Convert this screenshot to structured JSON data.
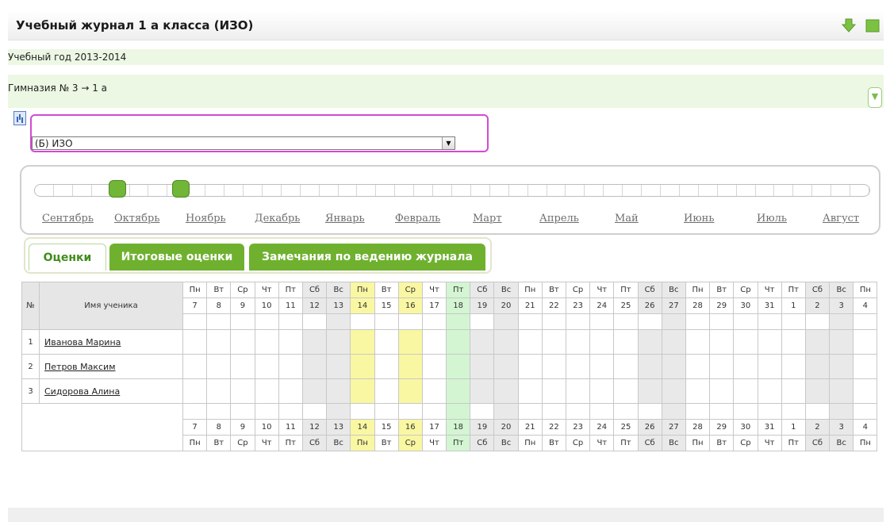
{
  "header": {
    "title": "Учебный журнал 1 а класса (ИЗО)",
    "download_icon": "arrow-down-icon",
    "excel_icon": "green-square-icon"
  },
  "school_year": "Учебный год 2013-2014",
  "class_path": "Гимназия № 3 → 1 а",
  "subject_select": {
    "value": "(Б) ИЗО"
  },
  "months": [
    "Сентябрь",
    "Октябрь",
    "Ноябрь",
    "Декабрь",
    "Январь",
    "Февраль",
    "Март",
    "Апрель",
    "Май",
    "Июнь",
    "Июль",
    "Август"
  ],
  "tabs": [
    "Оценки",
    "Итоговые оценки",
    "Замечания по ведению журнала"
  ],
  "table": {
    "num_header": "№",
    "name_header": "Имя ученика",
    "days": [
      {
        "wd": "Пн",
        "d": "7"
      },
      {
        "wd": "Вт",
        "d": "8"
      },
      {
        "wd": "Ср",
        "d": "9"
      },
      {
        "wd": "Чт",
        "d": "10"
      },
      {
        "wd": "Пт",
        "d": "11"
      },
      {
        "wd": "Сб",
        "d": "12"
      },
      {
        "wd": "Вс",
        "d": "13"
      },
      {
        "wd": "Пн",
        "d": "14"
      },
      {
        "wd": "Вт",
        "d": "15"
      },
      {
        "wd": "Ср",
        "d": "16"
      },
      {
        "wd": "Чт",
        "d": "17"
      },
      {
        "wd": "Пт",
        "d": "18"
      },
      {
        "wd": "Сб",
        "d": "19"
      },
      {
        "wd": "Вс",
        "d": "20"
      },
      {
        "wd": "Пн",
        "d": "21"
      },
      {
        "wd": "Вт",
        "d": "22"
      },
      {
        "wd": "Ср",
        "d": "23"
      },
      {
        "wd": "Чт",
        "d": "24"
      },
      {
        "wd": "Пт",
        "d": "25"
      },
      {
        "wd": "Сб",
        "d": "26"
      },
      {
        "wd": "Вс",
        "d": "27"
      },
      {
        "wd": "Пн",
        "d": "28"
      },
      {
        "wd": "Вт",
        "d": "29"
      },
      {
        "wd": "Ср",
        "d": "30"
      },
      {
        "wd": "Чт",
        "d": "31"
      },
      {
        "wd": "Пт",
        "d": "1"
      },
      {
        "wd": "Сб",
        "d": "2"
      },
      {
        "wd": "Вс",
        "d": "3"
      },
      {
        "wd": "Пн",
        "d": "4"
      }
    ],
    "students": [
      {
        "num": "1",
        "name": "Иванова Марина"
      },
      {
        "num": "2",
        "name": "Петров Максим"
      },
      {
        "num": "3",
        "name": "Сидорова Алина"
      }
    ]
  }
}
